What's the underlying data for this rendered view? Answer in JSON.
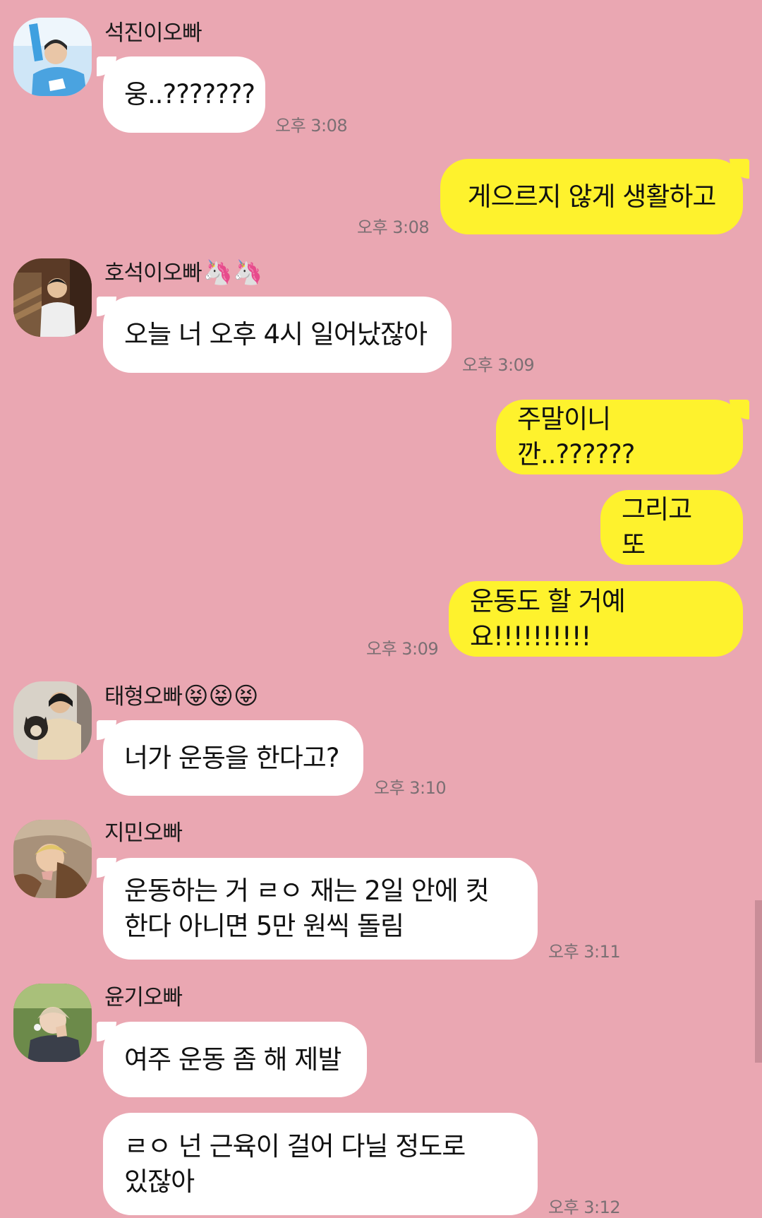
{
  "messages": [
    {
      "sender": "석진이오빠",
      "text": "웅..???????",
      "time": "오후 3:08"
    },
    {
      "me": true,
      "text": "게으르지 않게 생활하고",
      "time": "오후 3:08"
    },
    {
      "sender": "호석이오빠",
      "sender_emoji": "🦄🦄",
      "text": "오늘 너 오후 4시 일어났잖아",
      "time": "오후 3:09"
    },
    {
      "me": true,
      "text": "주말이니깐..??????"
    },
    {
      "me": true,
      "text": "그리고 또"
    },
    {
      "me": true,
      "text": "운동도 할 거예요!!!!!!!!!!",
      "time": "오후 3:09"
    },
    {
      "sender": "태형오빠",
      "sender_emoji": "😝😝😝",
      "text": "너가 운동을 한다고?",
      "time": "오후 3:10"
    },
    {
      "sender": "지민오빠",
      "text": "운동하는 거 ㄹㅇ 재는 2일 안에 컷\n한다 아니면 5만 원씩 돌림",
      "time": "오후 3:11"
    },
    {
      "sender": "윤기오빠",
      "text": "여주 운동 좀 해 제발"
    },
    {
      "text": "ㄹㅇ 넌 근육이 걸어 다닐 정도로\n있잖아",
      "time": "오후 3:12"
    }
  ],
  "avatars": {
    "a0": "photo-avatar-blue",
    "a2": "photo-avatar-street",
    "a6": "photo-avatar-dog",
    "a7": "photo-avatar-fur",
    "a8": "photo-avatar-earphone"
  }
}
